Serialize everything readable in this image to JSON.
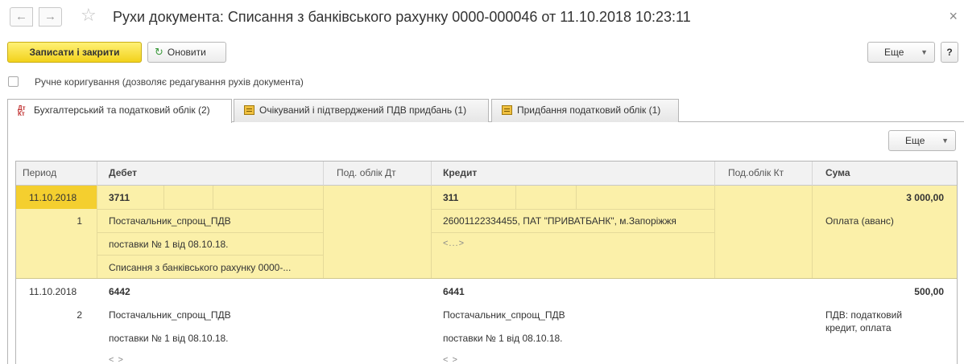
{
  "window": {
    "title": "Рухи документа: Списання з банківського рахунку 0000-000046 от 11.10.2018 10:23:11",
    "back_icon": "←",
    "forward_icon": "→",
    "star_icon": "☆",
    "close_icon": "×"
  },
  "toolbar": {
    "save_close_label": "Записати і закрити",
    "refresh_icon": "↻",
    "refresh_label": "Оновити",
    "more_label": "Еще",
    "help_label": "?"
  },
  "manual_edit": {
    "checked": false,
    "label": "Ручне коригування (дозволяє редагування рухів документа)"
  },
  "tabs": [
    {
      "label": "Бухгалтерський та податковий облік (2)",
      "active": true,
      "icon": "dt-kt-icon",
      "icon_text_top": "Дт",
      "icon_text_bottom": "Кт"
    },
    {
      "label": "Очікуваний і підтверджений ПДВ придбань (1)",
      "active": false,
      "icon": "register-icon"
    },
    {
      "label": "Придбання податковий облік (1)",
      "active": false,
      "icon": "register-icon"
    }
  ],
  "grid": {
    "more_label": "Еще",
    "columns": {
      "period": "Период",
      "debit": "Дебет",
      "tax_debit": "Под. облік Дт",
      "credit": "Кредит",
      "tax_credit": "Под.облік Кт",
      "sum": "Сума"
    },
    "rows": [
      {
        "period": "11.10.2018",
        "number": "1",
        "debit_account": "3711",
        "debit_sub1": "Постачальник_спрощ_ПДВ",
        "debit_sub2": "поставки № 1 від 08.10.18.",
        "debit_sub3": "Списання з банківського рахунку 0000-...",
        "credit_account": "311",
        "credit_sub1": "26001122334455, ПАТ \"ПРИВАТБАНК\", м.Запоріжжя",
        "credit_sub2": "<...>",
        "amount": "3 000,00",
        "content": "Оплата (аванс)",
        "selected": true
      },
      {
        "period": "11.10.2018",
        "number": "2",
        "debit_account": "6442",
        "debit_sub1": "Постачальник_спрощ_ПДВ",
        "debit_sub2": "поставки № 1 від 08.10.18.",
        "debit_sub3": "< >",
        "credit_account": "6441",
        "credit_sub1": "Постачальник_спрощ_ПДВ",
        "credit_sub2": "поставки № 1 від 08.10.18.",
        "credit_sub3": "< >",
        "amount": "500,00",
        "content": "ПДВ: податковий кредит, оплата",
        "selected": false
      }
    ]
  }
}
